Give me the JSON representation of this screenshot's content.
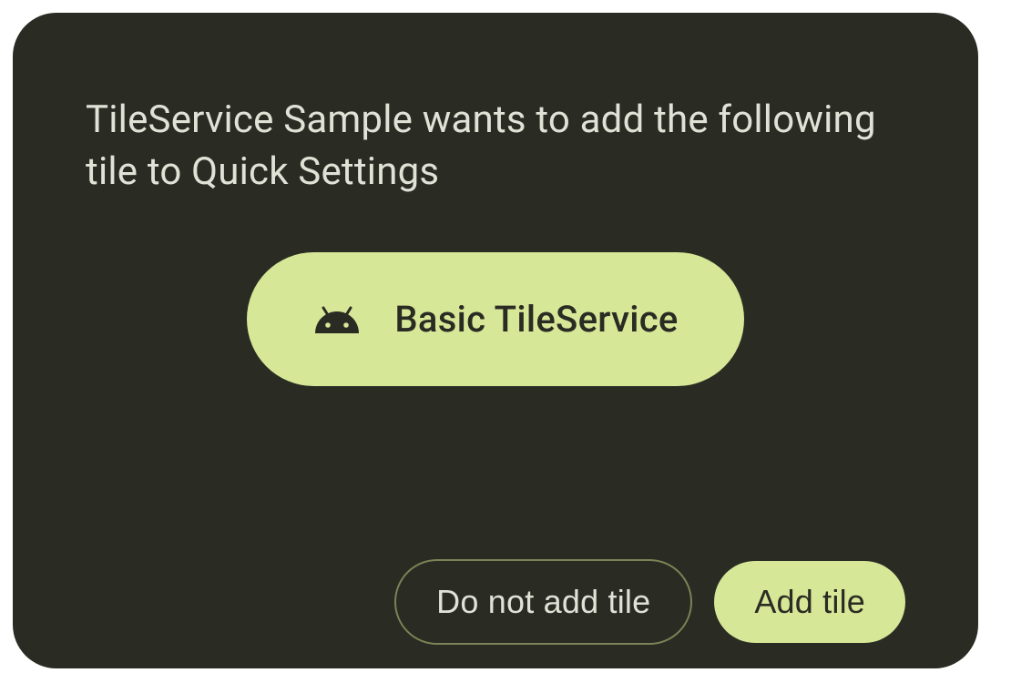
{
  "dialog": {
    "message": "TileService Sample wants to add the following tile to Quick Settings",
    "tile": {
      "label": "Basic TileService",
      "icon": "android-icon"
    },
    "actions": {
      "negative": "Do not add tile",
      "positive": "Add tile"
    }
  },
  "colors": {
    "background": "#2a2b23",
    "accent": "#d6e797",
    "text": "#e0e2d6",
    "outline": "#7a8456"
  }
}
